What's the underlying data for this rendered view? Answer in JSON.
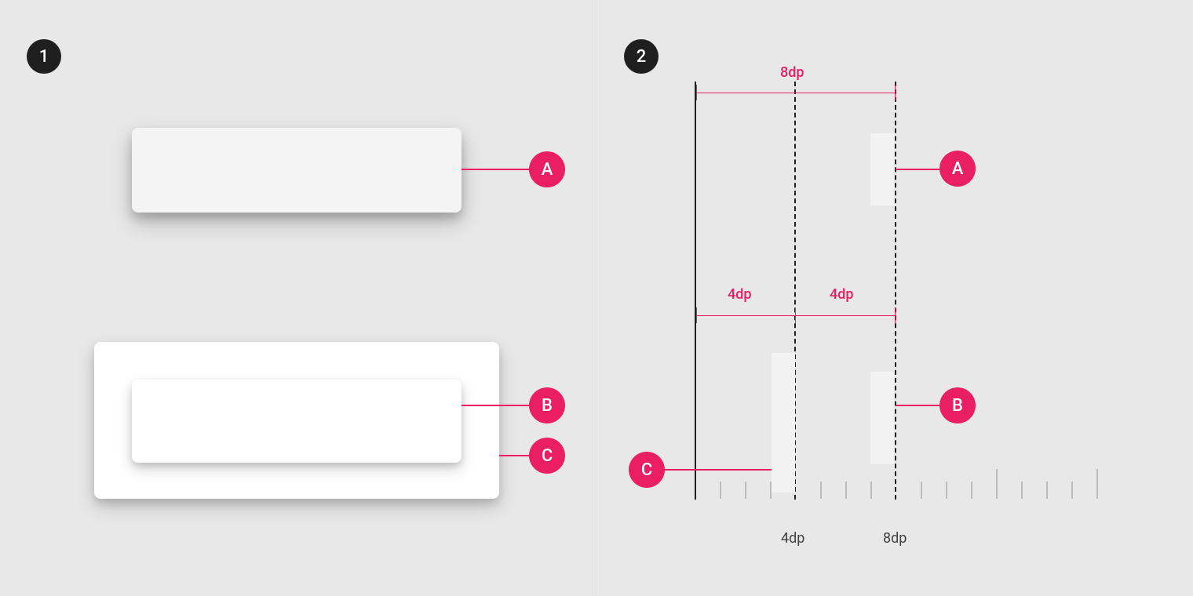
{
  "badges": {
    "panel1": "1",
    "panel2": "2"
  },
  "callouts": {
    "p1_a": "A",
    "p1_b": "B",
    "p1_c": "C",
    "p2_a": "A",
    "p2_b": "B",
    "p2_c": "C"
  },
  "measurements": {
    "top_8dp": "8dp",
    "mid_4dp_left": "4dp",
    "mid_4dp_right": "4dp",
    "axis_4dp": "4dp",
    "axis_8dp": "8dp"
  },
  "colors": {
    "accent": "#e91e63",
    "badge": "#1f1f1f",
    "background": "#e8e8e8",
    "surface_a": "#f4f4f4",
    "surface_bc": "#ffffff"
  },
  "diagram": {
    "axis_positions_dp": [
      0,
      4,
      8
    ],
    "ruler": {
      "tick_count": 17,
      "tall_ticks_at_dp": [
        0,
        4,
        8
      ]
    },
    "elements": {
      "A": {
        "resting_dp": 8,
        "container": null
      },
      "B": {
        "resting_dp": 4,
        "container": "C",
        "container_elevation_dp": 4,
        "absolute_dp": 8
      },
      "C": {
        "resting_dp": 4,
        "container": null
      }
    }
  }
}
